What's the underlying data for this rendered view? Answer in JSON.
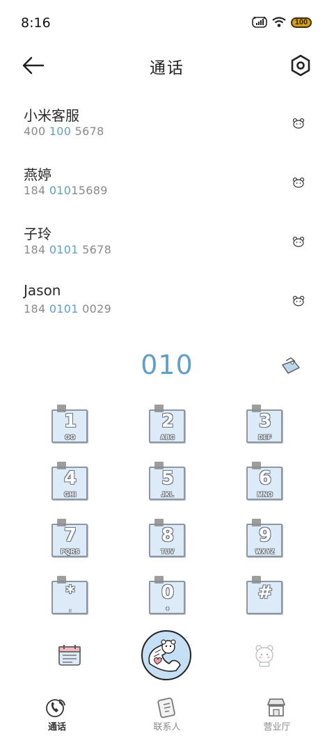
{
  "status": {
    "time": "8:16",
    "battery": "100"
  },
  "header": {
    "title": "通话"
  },
  "results": [
    {
      "name": "小米客服",
      "num_parts": [
        "400 ",
        "100",
        " 5678"
      ]
    },
    {
      "name": "燕婷",
      "num_parts": [
        "184 ",
        "010",
        "15689"
      ]
    },
    {
      "name": "子玲",
      "num_parts": [
        "184 ",
        "0101",
        " 5678"
      ]
    },
    {
      "name": "Jason",
      "num_parts": [
        "184 ",
        "0101",
        " 0029"
      ]
    }
  ],
  "dialpad": {
    "entered": "010",
    "keys": [
      {
        "digit": "1",
        "letters": "OO"
      },
      {
        "digit": "2",
        "letters": "ABC"
      },
      {
        "digit": "3",
        "letters": "DEF"
      },
      {
        "digit": "4",
        "letters": "GHI"
      },
      {
        "digit": "5",
        "letters": "JKL"
      },
      {
        "digit": "6",
        "letters": "MNO"
      },
      {
        "digit": "7",
        "letters": "PQRS"
      },
      {
        "digit": "8",
        "letters": "TUV"
      },
      {
        "digit": "9",
        "letters": "WXYZ"
      },
      {
        "digit": "*",
        "letters": ","
      },
      {
        "digit": "0",
        "letters": "+"
      },
      {
        "digit": "#",
        "letters": ""
      }
    ]
  },
  "nav": {
    "calls": "通话",
    "contacts": "联系人",
    "store": "营业厅"
  },
  "colors": {
    "accent": "#5f9fc9",
    "key_bg": "#dcebf7",
    "dial_bg": "#c5dff4"
  },
  "icons": {
    "back": "back-arrow-icon",
    "settings": "settings-icon",
    "info": "bear-face-icon",
    "delete": "delete-icon",
    "calendar": "calendar-icon",
    "bear": "bear-sticker-icon",
    "call": "call-icon",
    "contacts": "contacts-icon",
    "store": "store-icon"
  }
}
